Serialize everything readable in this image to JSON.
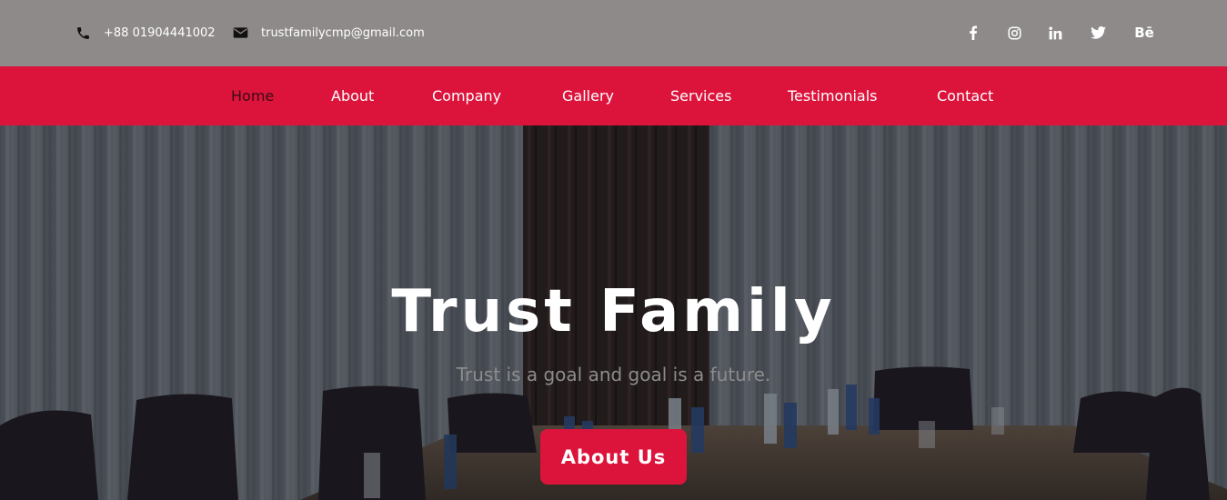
{
  "topbar": {
    "phone": "+88 01904441002",
    "email": "trustfamilycmp@gmail.com",
    "social": [
      {
        "icon": "facebook-icon",
        "glyph": "f"
      },
      {
        "icon": "instagram-icon",
        "glyph": ""
      },
      {
        "icon": "linkedin-icon",
        "glyph": "in"
      },
      {
        "icon": "twitter-icon",
        "glyph": ""
      },
      {
        "icon": "behance-icon",
        "glyph": "Bē"
      }
    ]
  },
  "nav": {
    "items": [
      {
        "label": "Home",
        "active": true
      },
      {
        "label": "About"
      },
      {
        "label": "Company"
      },
      {
        "label": "Gallery"
      },
      {
        "label": "Services"
      },
      {
        "label": "Testimonials"
      },
      {
        "label": "Contact"
      }
    ]
  },
  "hero": {
    "title": "Trust Family",
    "subtitle": "Trust is a goal and goal is a future.",
    "cta_label": "About Us"
  },
  "colors": {
    "brand": "#dc143c",
    "topbar": "#8e8a8a"
  }
}
